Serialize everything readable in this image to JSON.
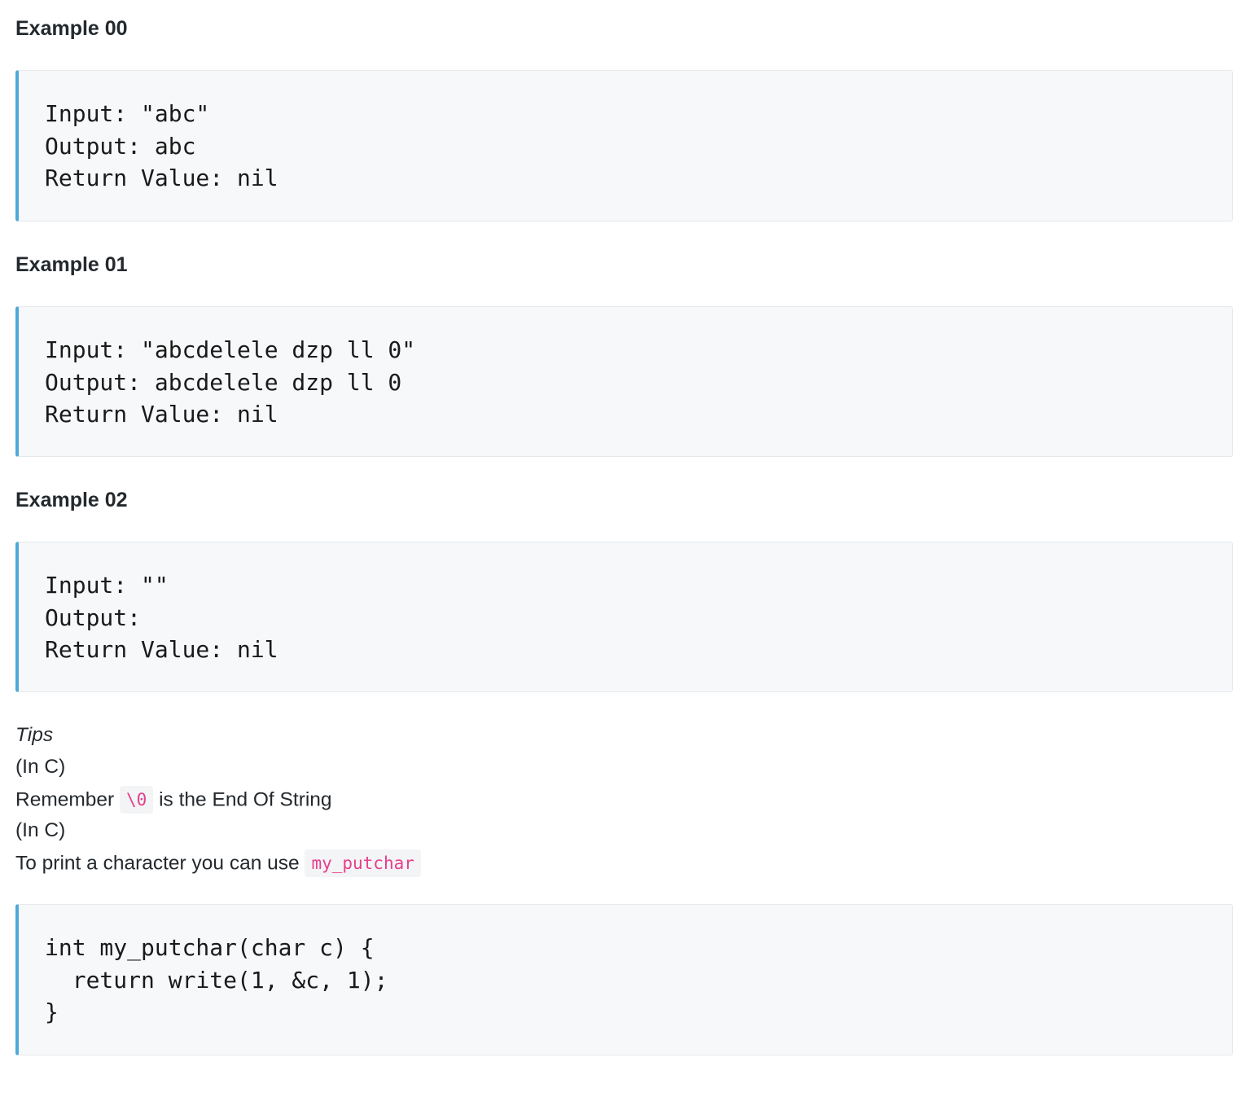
{
  "examples": [
    {
      "heading": "Example 00",
      "code": "Input: \"abc\"\nOutput: abc\nReturn Value: nil"
    },
    {
      "heading": "Example 01",
      "code": "Input: \"abcdelele dzp ll 0\"\nOutput: abcdelele dzp ll 0\nReturn Value: nil"
    },
    {
      "heading": "Example 02",
      "code": "Input: \"\"\nOutput:\nReturn Value: nil"
    }
  ],
  "tips": {
    "title": "Tips",
    "line1": "(In C)",
    "line2_before": "Remember",
    "line2_code": "\\0",
    "line2_after": "is the End Of String",
    "line3": "(In C)",
    "line4_before": "To print a character you can use",
    "line4_code": "my_putchar",
    "code": "int my_putchar(char c) {\n  return write(1, &c, 1);\n}"
  },
  "colors": {
    "accent_border": "#4ea9d8",
    "code_background": "#f6f8fa",
    "inline_code_text": "#e83e8c"
  }
}
